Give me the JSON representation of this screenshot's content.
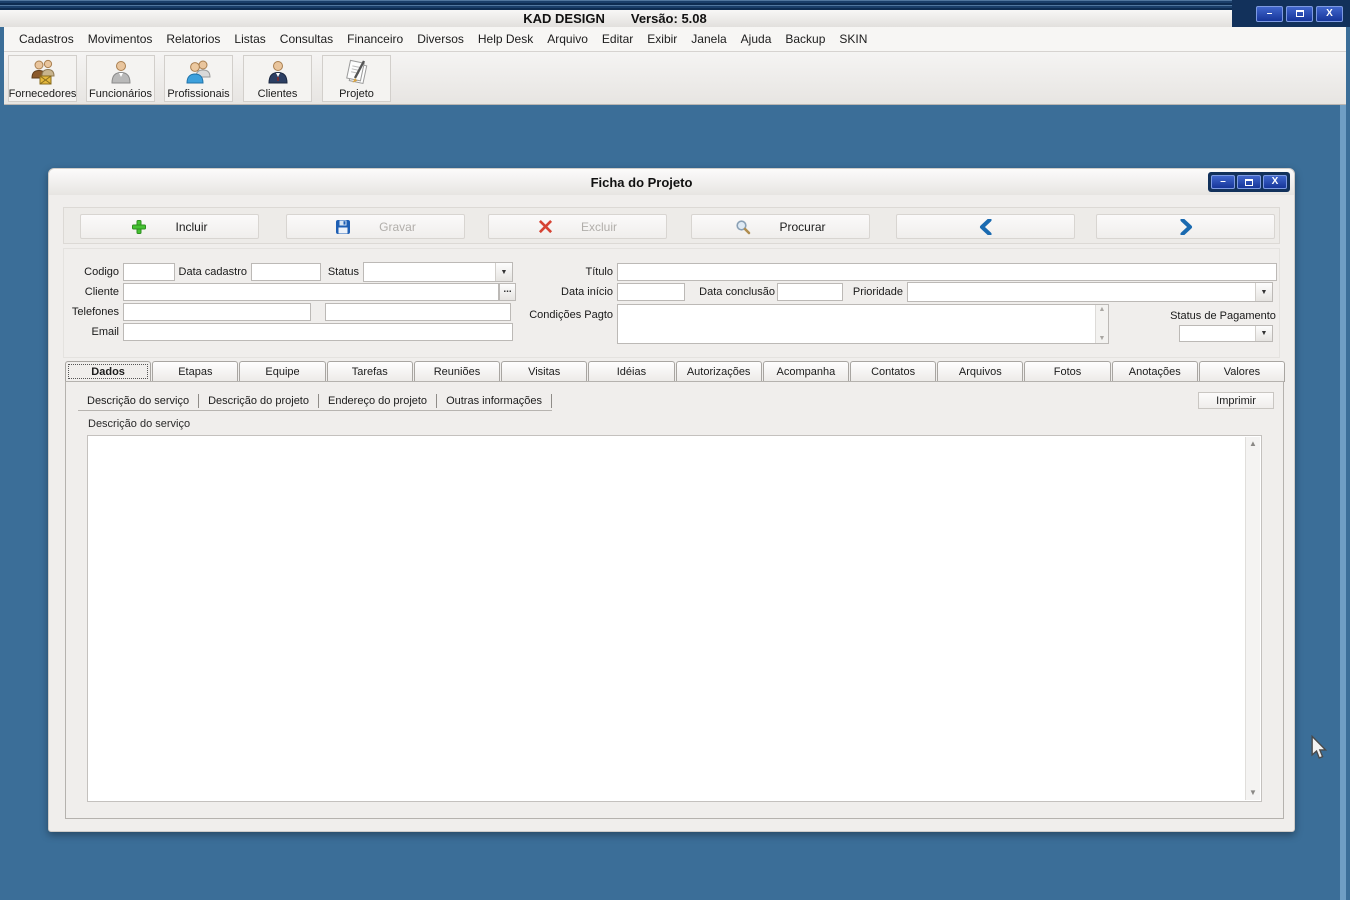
{
  "titlebar": {
    "app_name": "KAD DESIGN",
    "version": "Versão: 5.08"
  },
  "glyphs": {
    "minimize": "–",
    "close": "X",
    "dropdown": "▼",
    "scroll_up": "▲",
    "scroll_down": "▼"
  },
  "menu": {
    "items": [
      "Cadastros",
      "Movimentos",
      "Relatorios",
      "Listas",
      "Consultas",
      "Financeiro",
      "Diversos",
      "Help Desk",
      "Arquivo",
      "Editar",
      "Exibir",
      "Janela",
      "Ajuda",
      "Backup",
      "SKIN"
    ]
  },
  "toolbar": {
    "buttons": [
      {
        "label": "Fornecedores",
        "icon": "suppliers-people-icon"
      },
      {
        "label": "Funcionários",
        "icon": "employee-person-icon"
      },
      {
        "label": "Profissionais",
        "icon": "professionals-people-icon"
      },
      {
        "label": "Clientes",
        "icon": "client-person-icon"
      },
      {
        "label": "Projeto",
        "icon": "project-notes-icon"
      }
    ]
  },
  "dialog": {
    "title": "Ficha do Projeto",
    "actions": [
      {
        "label": "Incluir",
        "icon": "plus-icon",
        "enabled": true
      },
      {
        "label": "Gravar",
        "icon": "save-floppy-icon",
        "enabled": false
      },
      {
        "label": "Excluir",
        "icon": "delete-x-icon",
        "enabled": false
      },
      {
        "label": "Procurar",
        "icon": "search-icon",
        "enabled": true
      },
      {
        "label": "",
        "icon": "chevron-left-icon",
        "enabled": true
      },
      {
        "label": "",
        "icon": "chevron-right-icon",
        "enabled": true
      }
    ],
    "fields": {
      "codigo": "Codigo",
      "data_cadastro": "Data cadastro",
      "status": "Status",
      "cliente": "Cliente",
      "browse": "...",
      "telefones": "Telefones",
      "email": "Email",
      "titulo": "Título",
      "data_inicio": "Data início",
      "data_conclusao": "Data conclusão",
      "prioridade": "Prioridade",
      "condicoes_pagto": "Condições Pagto",
      "status_pagamento": "Status de Pagamento"
    },
    "field_values": {
      "codigo": "",
      "data_cadastro": "",
      "status": "",
      "cliente": "",
      "telefone1": "",
      "telefone2": "",
      "email": "",
      "titulo": "",
      "data_inicio": "",
      "data_conclusao": "",
      "prioridade": "",
      "condicoes_pagto": "",
      "status_pagamento": ""
    },
    "tabs": [
      "Dados",
      "Etapas",
      "Equipe",
      "Tarefas",
      "Reuniões",
      "Visitas",
      "Idéias",
      "Autorizações",
      "Acompanha",
      "Contatos",
      "Arquivos",
      "Fotos",
      "Anotações",
      "Valores"
    ],
    "active_tab": "Dados",
    "subtabs": [
      "Descrição do serviço",
      "Descrição do projeto",
      "Endereço do projeto",
      "Outras informações"
    ],
    "active_subtab": "Descrição do serviço",
    "imprimir_label": "Imprimir",
    "textarea_label": "Descrição do serviço",
    "textarea_value": ""
  },
  "colors": {
    "desktop_blue": "#3b6e98",
    "titlebar_navy": "#12315b",
    "control_button_blue": "#2a50b4",
    "accent_green": "#3fbe2e",
    "accent_red": "#d64333",
    "accent_blue": "#1a6ab0",
    "disabled_text": "#b1aeaa",
    "panel_gray": "#f0eeec"
  }
}
